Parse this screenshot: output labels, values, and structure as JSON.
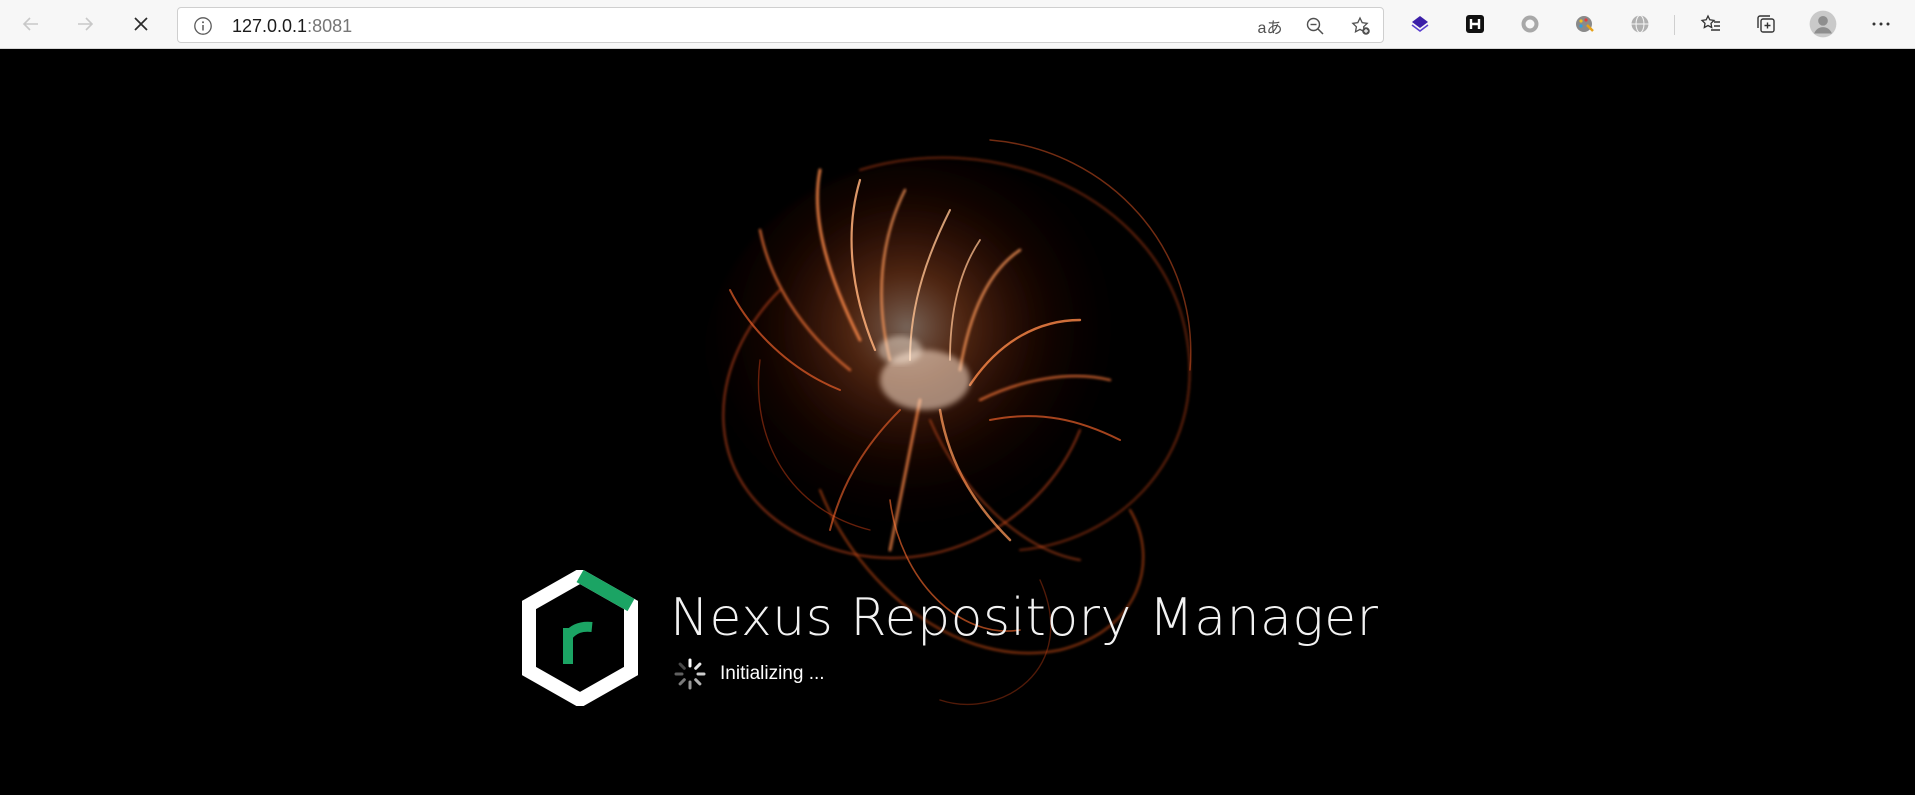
{
  "browser": {
    "address": {
      "host": "127.0.0.1",
      "port": ":8081"
    },
    "icons": {
      "back": "back-arrow-icon",
      "forward": "forward-arrow-icon",
      "stop": "close-icon",
      "info": "info-icon",
      "read_aloud": "read-aloud-icon",
      "zoom": "zoom-out-icon",
      "favorite": "add-favorite-icon",
      "favorites": "favorites-icon",
      "collections": "collections-icon",
      "profile": "profile-avatar-icon",
      "menu": "more-icon"
    },
    "read_aloud_glyph": "aあ",
    "extensions": [
      {
        "name": "layers-extension-icon",
        "color": "#3b1fa8"
      },
      {
        "name": "h-extension-icon",
        "glyph": "H",
        "color": "#111111"
      },
      {
        "name": "circle-extension-icon",
        "color": "#9a9a9a"
      },
      {
        "name": "color-picker-extension-icon",
        "color": "#888888"
      },
      {
        "name": "globe-extension-icon",
        "color": "#a0a0a0"
      }
    ]
  },
  "page": {
    "product_name": "Nexus Repository Manager",
    "status": "Initializing ...",
    "logo_letter": "r",
    "colors": {
      "background": "#000000",
      "brand_green": "#1ba464",
      "flame": "#ff6a2e"
    }
  }
}
